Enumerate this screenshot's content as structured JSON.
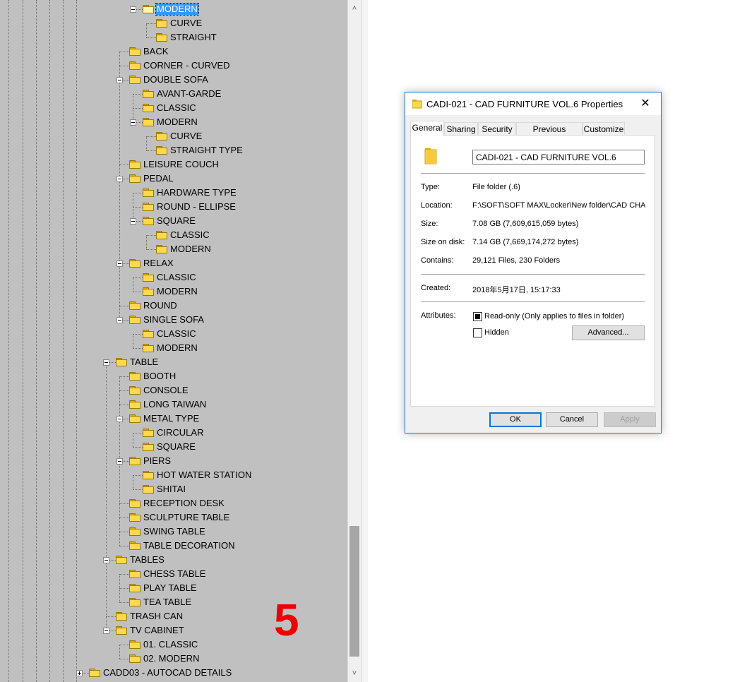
{
  "tree": {
    "nodes": [
      {
        "label": "MODERN",
        "level": 2,
        "state": "expanded",
        "selected": true
      },
      {
        "label": "CURVE",
        "level": 3
      },
      {
        "label": "STRAIGHT",
        "level": 3
      },
      {
        "label": "BACK",
        "level": 1
      },
      {
        "label": "CORNER - CURVED",
        "level": 1
      },
      {
        "label": "DOUBLE SOFA",
        "level": 1,
        "state": "expanded"
      },
      {
        "label": "AVANT-GARDE",
        "level": 2
      },
      {
        "label": "CLASSIC",
        "level": 2
      },
      {
        "label": "MODERN",
        "level": 2,
        "state": "expanded"
      },
      {
        "label": "CURVE",
        "level": 3
      },
      {
        "label": "STRAIGHT TYPE",
        "level": 3
      },
      {
        "label": "LEISURE COUCH",
        "level": 1
      },
      {
        "label": "PEDAL",
        "level": 1,
        "state": "expanded"
      },
      {
        "label": "HARDWARE TYPE",
        "level": 2
      },
      {
        "label": "ROUND - ELLIPSE",
        "level": 2
      },
      {
        "label": "SQUARE",
        "level": 2,
        "state": "expanded"
      },
      {
        "label": "CLASSIC",
        "level": 3
      },
      {
        "label": "MODERN",
        "level": 3
      },
      {
        "label": "RELAX",
        "level": 1,
        "state": "expanded"
      },
      {
        "label": "CLASSIC",
        "level": 2
      },
      {
        "label": "MODERN",
        "level": 2
      },
      {
        "label": "ROUND",
        "level": 1
      },
      {
        "label": "SINGLE SOFA",
        "level": 1,
        "state": "expanded"
      },
      {
        "label": "CLASSIC",
        "level": 2
      },
      {
        "label": "MODERN",
        "level": 2
      },
      {
        "label": "TABLE",
        "level": 0,
        "state": "expanded"
      },
      {
        "label": "BOOTH",
        "level": 1
      },
      {
        "label": "CONSOLE",
        "level": 1
      },
      {
        "label": "LONG TAIWAN",
        "level": 1
      },
      {
        "label": "METAL TYPE",
        "level": 1,
        "state": "expanded"
      },
      {
        "label": "CIRCULAR",
        "level": 2
      },
      {
        "label": "SQUARE",
        "level": 2
      },
      {
        "label": "PIERS",
        "level": 1,
        "state": "expanded"
      },
      {
        "label": "HOT WATER STATION",
        "level": 2
      },
      {
        "label": "SHITAI",
        "level": 2
      },
      {
        "label": "RECEPTION DESK",
        "level": 1
      },
      {
        "label": "SCULPTURE TABLE",
        "level": 1
      },
      {
        "label": "SWING TABLE",
        "level": 1
      },
      {
        "label": "TABLE DECORATION",
        "level": 1
      },
      {
        "label": "TABLES",
        "level": 0,
        "state": "expanded"
      },
      {
        "label": "CHESS TABLE",
        "level": 1
      },
      {
        "label": "PLAY TABLE",
        "level": 1
      },
      {
        "label": "TEA TABLE",
        "level": 1
      },
      {
        "label": "TRASH CAN",
        "level": 0
      },
      {
        "label": "TV CABINET",
        "level": 0,
        "state": "expanded"
      },
      {
        "label": "01. CLASSIC",
        "level": 1
      },
      {
        "label": "02. MODERN",
        "level": 1
      },
      {
        "label": "CADD03 - AUTOCAD DETAILS",
        "level": -2,
        "state": "collapsed"
      }
    ]
  },
  "scrollbar": {
    "up_glyph": "˄",
    "down_glyph": "˅"
  },
  "overlay_number": "5",
  "dialog": {
    "title": "CADI-021 - CAD FURNITURE VOL.6 Properties",
    "close_glyph": "✕",
    "tabs": [
      {
        "label": "General",
        "active": true
      },
      {
        "label": "Sharing"
      },
      {
        "label": "Security"
      },
      {
        "label": "Previous Versions"
      },
      {
        "label": "Customize"
      }
    ],
    "folder_name": "CADI-021 - CAD FURNITURE VOL.6",
    "properties": {
      "type_label": "Type:",
      "type_value": "File folder (.6)",
      "location_label": "Location:",
      "location_value": "F:\\SOFT\\SOFT MAX\\Locker\\New folder\\CAD CHA",
      "size_label": "Size:",
      "size_value": "7.08 GB (7,609,615,059 bytes)",
      "size_on_disk_label": "Size on disk:",
      "size_on_disk_value": "7.14 GB (7,669,174,272 bytes)",
      "contains_label": "Contains:",
      "contains_value": "29,121 Files, 230 Folders",
      "created_label": "Created:",
      "created_value": "2018年5月17日, 15:17:33",
      "attributes_label": "Attributes:",
      "readonly_label": "Read-only (Only applies to files in folder)",
      "readonly_state": "indeterminate",
      "hidden_label": "Hidden",
      "hidden_state": "unchecked",
      "advanced_label": "Advanced..."
    },
    "buttons": {
      "ok": "OK",
      "cancel": "Cancel",
      "apply": "Apply"
    }
  }
}
